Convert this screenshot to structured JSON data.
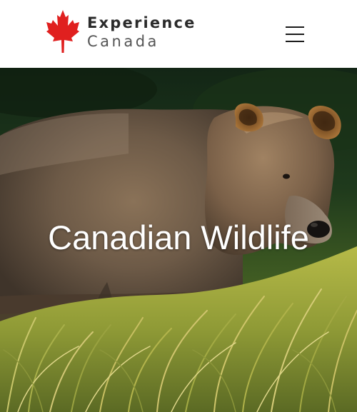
{
  "header": {
    "logo": {
      "line1": "Experience",
      "line2": "Canada",
      "icon": "maple-leaf-icon"
    },
    "menu": {
      "icon": "hamburger-menu-icon"
    }
  },
  "hero": {
    "title": "Canadian Wildlife",
    "image": "grizzly-bear-photo"
  },
  "colors": {
    "maple_red": "#e0201f",
    "text_dark": "#2b2b2b",
    "text_gray": "#555555",
    "hero_text": "#ffffff"
  }
}
